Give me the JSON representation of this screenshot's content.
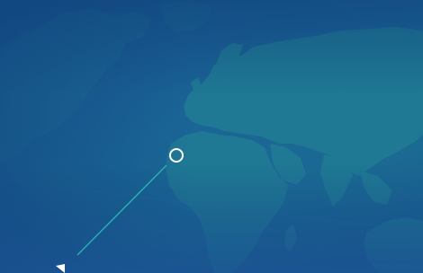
{
  "colors": {
    "background": "#17558f",
    "land": "#1f7894",
    "land_dim": "#1b6a8e",
    "accent_line": "#27b3b0",
    "marker_stroke": "#ffffff"
  },
  "icons": {
    "location_marker": "ring-marker-icon",
    "pointer": "triangle-pointer-icon"
  }
}
